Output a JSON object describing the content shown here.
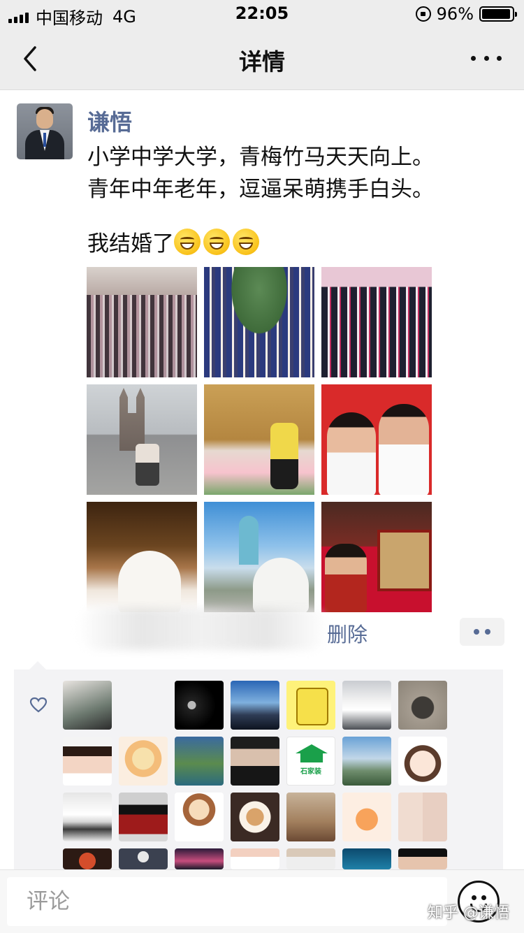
{
  "status_bar": {
    "carrier": "中国移动",
    "network": "4G",
    "time": "22:05",
    "battery": "96%",
    "battery_level": 0.96
  },
  "nav": {
    "title": "详情",
    "back_icon": "chevron-left-icon",
    "more_icon": "more-dots-icon"
  },
  "post": {
    "author": "谦悟",
    "text": "小学中学大学，青梅竹马天天向上。\n青年中年老年，逗逼呆萌携手白头。",
    "text_tail": "我结婚了",
    "emoji_count": 3,
    "photos": [
      {
        "name": "primary-school-class-photo"
      },
      {
        "name": "middle-school-class-photo"
      },
      {
        "name": "university-class-photo"
      },
      {
        "name": "church-couple-photo"
      },
      {
        "name": "marriage-registry-photo"
      },
      {
        "name": "marriage-certificate-photo"
      },
      {
        "name": "wedding-gown-photo"
      },
      {
        "name": "outdoor-wedding-photo"
      },
      {
        "name": "traditional-wedding-photo"
      }
    ],
    "delete_label": "删除"
  },
  "likes": {
    "icon": "heart-icon",
    "avatar_count": 28
  },
  "comment_bar": {
    "placeholder": "评论",
    "emoji_icon": "smiley-icon"
  },
  "watermark": "知乎 @谦悟",
  "colors": {
    "link_blue": "#576b95",
    "nav_bg": "#ededed",
    "likes_bg": "#f3f3f5"
  }
}
